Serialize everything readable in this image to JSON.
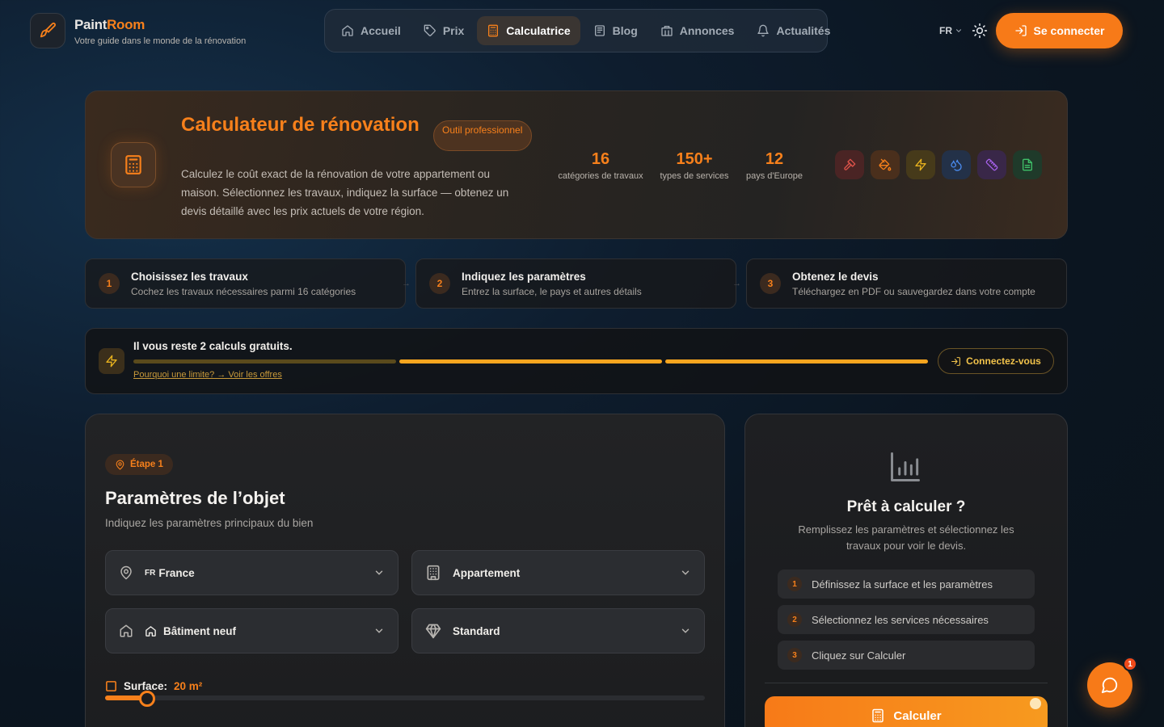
{
  "header": {
    "brand_part1": "Paint",
    "brand_part2": "Room",
    "tagline": "Votre guide dans le monde de la rénovation",
    "nav": [
      {
        "label": "Accueil",
        "icon": "home-icon"
      },
      {
        "label": "Prix",
        "icon": "tag-icon"
      },
      {
        "label": "Calculatrice",
        "icon": "calculator-icon",
        "active": true
      },
      {
        "label": "Blog",
        "icon": "newspaper-icon"
      },
      {
        "label": "Annonces",
        "icon": "store-icon"
      },
      {
        "label": "Actualités",
        "icon": "bell-icon"
      }
    ],
    "language": "FR",
    "login_label": "Se connecter"
  },
  "hero": {
    "title": "Calculateur de rénovation",
    "badge": "Outil professionnel",
    "description": "Calculez le coût exact de la rénovation de votre appartement ou maison. Sélectionnez les travaux, indiquez la surface — obtenez un devis détaillé avec les prix actuels de votre région.",
    "stats": [
      {
        "value": "16",
        "label": "catégories de travaux"
      },
      {
        "value": "150+",
        "label": "types de services"
      },
      {
        "value": "12",
        "label": "pays d'Europe"
      }
    ],
    "category_icons": [
      {
        "name": "hammer-icon",
        "color": "#e0534a"
      },
      {
        "name": "paint-bucket-icon",
        "color": "#f7801b"
      },
      {
        "name": "lightning-icon",
        "color": "#e8b21e"
      },
      {
        "name": "droplets-icon",
        "color": "#4a8bef"
      },
      {
        "name": "ruler-icon",
        "color": "#a560e8"
      },
      {
        "name": "file-icon",
        "color": "#3fbf68"
      }
    ]
  },
  "steps": [
    {
      "num": "1",
      "title": "Choisissez les travaux",
      "sub": "Cochez les travaux nécessaires parmi 16 catégories"
    },
    {
      "num": "2",
      "title": "Indiquez les paramètres",
      "sub": "Entrez la surface, le pays et autres détails"
    },
    {
      "num": "3",
      "title": "Obtenez le devis",
      "sub": "Téléchargez en PDF ou sauvegardez dans votre compte"
    }
  ],
  "quota": {
    "title": "Il vous reste 2 calculs gratuits.",
    "link": "Pourquoi une limite? → Voir les offres",
    "button": "Connectez-vous",
    "used": 1,
    "total": 3,
    "colors": {
      "used": "#5a4a1c",
      "remaining": "#f7a51f"
    }
  },
  "form": {
    "badge": "Étape 1",
    "title": "Paramètres de l’objet",
    "subtitle": "Indiquez les paramètres principaux du bien",
    "country_code": "FR",
    "country": "France",
    "property_type": "Appartement",
    "building": "Bâtiment neuf",
    "quality": "Standard",
    "surface_label": "Surface:",
    "surface_value": "20 m²",
    "surface_fraction": 0.07
  },
  "summary": {
    "title": "Prêt à calculer ?",
    "subtitle": "Remplissez les paramètres et sélectionnez les travaux pour voir le devis.",
    "steps": [
      {
        "num": "1",
        "label": "Définissez la surface et les paramètres"
      },
      {
        "num": "2",
        "label": "Sélectionnez les services nécessaires"
      },
      {
        "num": "3",
        "label": "Cliquez sur Calculer"
      }
    ],
    "button": "Calculer"
  },
  "chat": {
    "badge": "1"
  },
  "colors": {
    "accent": "#f7801b"
  }
}
